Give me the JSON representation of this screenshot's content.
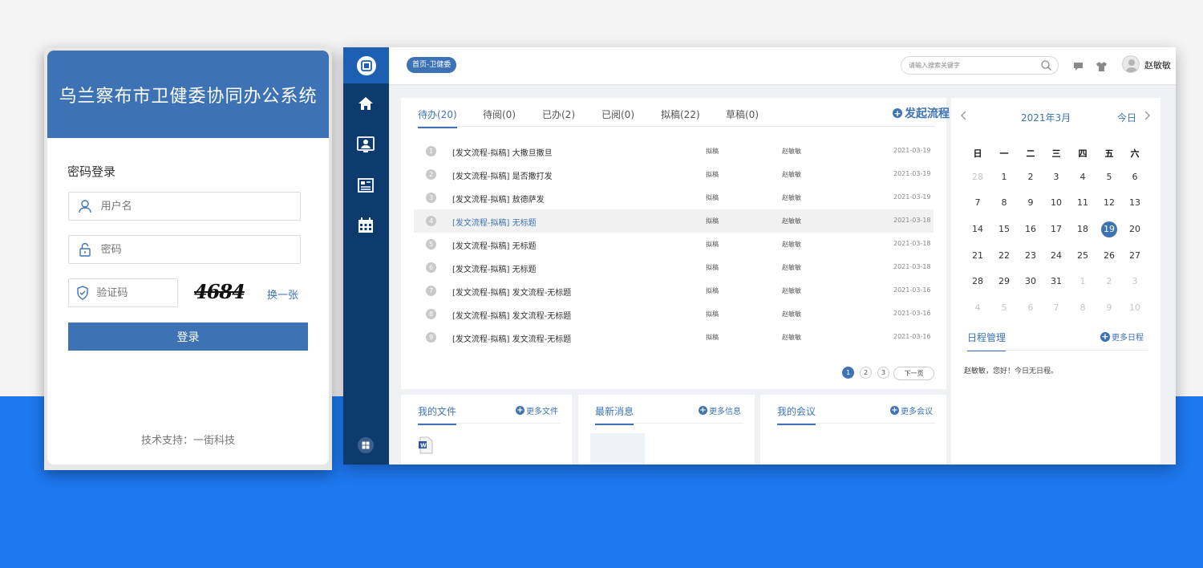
{
  "login": {
    "system_title": "乌兰察布市卫健委协同办公系统",
    "mode_label": "密码登录",
    "username_placeholder": "用户名",
    "password_placeholder": "密码",
    "captcha_placeholder": "验证码",
    "captcha_text": "4684",
    "refresh_label": "换一张",
    "submit_label": "登录",
    "support_text": "技术支持：一街科技"
  },
  "header": {
    "breadcrumb": "首页-卫健委",
    "search_placeholder": "请输入搜索关键字",
    "user_name": "赵敏敏",
    "icons": [
      "message-icon",
      "shirt-icon",
      "avatar"
    ]
  },
  "sidebar": {
    "items": [
      "home-icon",
      "contacts-icon",
      "document-icon",
      "calendar-icon",
      "apps-icon"
    ]
  },
  "tasks": {
    "tabs": [
      {
        "label": "待办(20)",
        "active": true
      },
      {
        "label": "待阅(0)"
      },
      {
        "label": "已办(2)"
      },
      {
        "label": "已阅(0)"
      },
      {
        "label": "拟稿(22)"
      },
      {
        "label": "草稿(0)"
      }
    ],
    "launch_label": "发起流程",
    "rows": [
      {
        "num": "1",
        "title": "[发文流程-拟稿] 大撒旦撒旦",
        "type": "拟稿",
        "person": "赵敏敏",
        "date": "2021-03-19"
      },
      {
        "num": "2",
        "title": "[发文流程-拟稿] 是否撒打发",
        "type": "拟稿",
        "person": "赵敏敏",
        "date": "2021-03-19"
      },
      {
        "num": "3",
        "title": "[发文流程-拟稿] 敖德萨发",
        "type": "拟稿",
        "person": "赵敏敏",
        "date": "2021-03-19"
      },
      {
        "num": "4",
        "title": "[发文流程-拟稿] 无标题",
        "type": "拟稿",
        "person": "赵敏敏",
        "date": "2021-03-18"
      },
      {
        "num": "5",
        "title": "[发文流程-拟稿] 无标题",
        "type": "拟稿",
        "person": "赵敏敏",
        "date": "2021-03-18"
      },
      {
        "num": "6",
        "title": "[发文流程-拟稿] 无标题",
        "type": "拟稿",
        "person": "赵敏敏",
        "date": "2021-03-18"
      },
      {
        "num": "7",
        "title": "[发文流程-拟稿] 发文流程-无标题",
        "type": "拟稿",
        "person": "赵敏敏",
        "date": "2021-03-16"
      },
      {
        "num": "8",
        "title": "[发文流程-拟稿] 发文流程-无标题",
        "type": "拟稿",
        "person": "赵敏敏",
        "date": "2021-03-16"
      },
      {
        "num": "9",
        "title": "[发文流程-拟稿] 发文流程-无标题",
        "type": "拟稿",
        "person": "赵敏敏",
        "date": "2021-03-16"
      }
    ],
    "pagination": {
      "pages": [
        "1",
        "2",
        "3"
      ],
      "current": "1",
      "next_label": "下一页"
    }
  },
  "cards": [
    {
      "title": "我的文件",
      "more": "更多文件"
    },
    {
      "title": "最新消息",
      "more": "更多信息"
    },
    {
      "title": "我的会议",
      "more": "更多会议"
    }
  ],
  "calendar": {
    "month_label": "2021年3月",
    "today_label": "今日",
    "weekdays": [
      "日",
      "一",
      "二",
      "三",
      "四",
      "五",
      "六"
    ],
    "weeks": [
      [
        "28",
        "1",
        "2",
        "3",
        "4",
        "5",
        "6"
      ],
      [
        "7",
        "8",
        "9",
        "10",
        "11",
        "12",
        "13"
      ],
      [
        "14",
        "15",
        "16",
        "17",
        "18",
        "19",
        "20"
      ],
      [
        "21",
        "22",
        "23",
        "24",
        "25",
        "26",
        "27"
      ],
      [
        "28",
        "29",
        "30",
        "31",
        "1",
        "2",
        "3"
      ],
      [
        "4",
        "5",
        "6",
        "7",
        "8",
        "9",
        "10"
      ]
    ],
    "today": "19",
    "schedule_title": "日程管理",
    "schedule_more": "更多日程",
    "schedule_text": "赵敏敏，您好！今日无日程。"
  },
  "colors": {
    "primary": "#3d73b5",
    "sidebar": "#0d3b6e",
    "page_band": "#1e78f0"
  }
}
